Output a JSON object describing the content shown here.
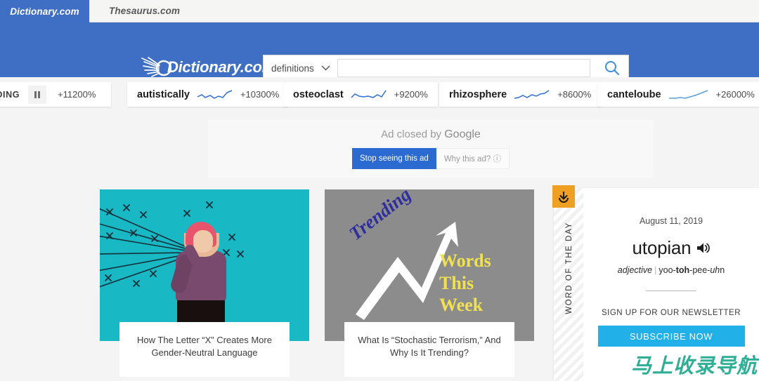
{
  "site_tabs": [
    {
      "label": "Dictionary.com",
      "active": true
    },
    {
      "label": "Thesaurus.com",
      "active": false
    }
  ],
  "header": {
    "logo_text": "Dictionary.com",
    "logo_icon": "sunburst-icon",
    "search": {
      "mode_label": "definitions",
      "dropdown_icon": "chevron-down-icon",
      "input_value": "",
      "input_placeholder": "",
      "submit_icon": "search-icon"
    },
    "background_color": "#3f6fc4"
  },
  "trending": {
    "label": "TRENDING",
    "pause_icon": "pause-icon",
    "first_percent": "+11200%",
    "items": [
      {
        "word": "autistically",
        "percent": "+10300%",
        "spark_icon": "sparkline-icon"
      },
      {
        "word": "osteoclast",
        "percent": "+9200%",
        "spark_icon": "sparkline-icon"
      },
      {
        "word": "rhizosphere",
        "percent": "+8600%",
        "spark_icon": "sparkline-icon"
      },
      {
        "word": "canteloube",
        "percent": "+26000%",
        "spark_icon": "sparkline-icon"
      }
    ],
    "spark_color": "#2f6fd0"
  },
  "ad": {
    "title_prefix": "Ad closed by ",
    "title_brand": "Google",
    "stop_label": "Stop seeing this ad",
    "why_label": "Why this ad? ⓘ",
    "stop_color": "#2b6ad0"
  },
  "articles": [
    {
      "caption": "How The Letter “X” Creates More Gender-Neutral Language",
      "image_bg": "#18b8c4",
      "image_alt": "person-with-x-marks-photo"
    },
    {
      "caption": "What Is “Stochastic Terrorism,” And Why Is It Trending?",
      "image_bg": "#8c8c8c",
      "image_alt": "trending-words-this-week-graphic",
      "graphic": {
        "trending_word": "Trending",
        "trending_color": "#2e2e9e",
        "headline": "Words\nThis\nWeek",
        "headline_color": "#f2e14e",
        "arrow_icon": "up-arrow-icon"
      }
    }
  ],
  "word_of_the_day": {
    "rail_label": "WORD OF THE DAY",
    "download_icon": "download-icon",
    "download_bg": "#efa023",
    "date": "August 11, 2019",
    "word": "utopian",
    "audio_icon": "speaker-icon",
    "part_of_speech": "adjective",
    "separator": "|",
    "pronunciation": [
      {
        "text": "yoo-",
        "style": "plain"
      },
      {
        "text": "toh",
        "style": "bold"
      },
      {
        "text": "-pee-",
        "style": "plain"
      },
      {
        "text": "uh",
        "style": "italic"
      },
      {
        "text": "n",
        "style": "plain"
      }
    ],
    "newsletter_label": "SIGN UP FOR OUR NEWSLETTER",
    "subscribe_label": "SUBSCRIBE NOW",
    "subscribe_color": "#21b0e8"
  },
  "watermark": {
    "text": "马上收录导航",
    "color": "#2fae96"
  }
}
